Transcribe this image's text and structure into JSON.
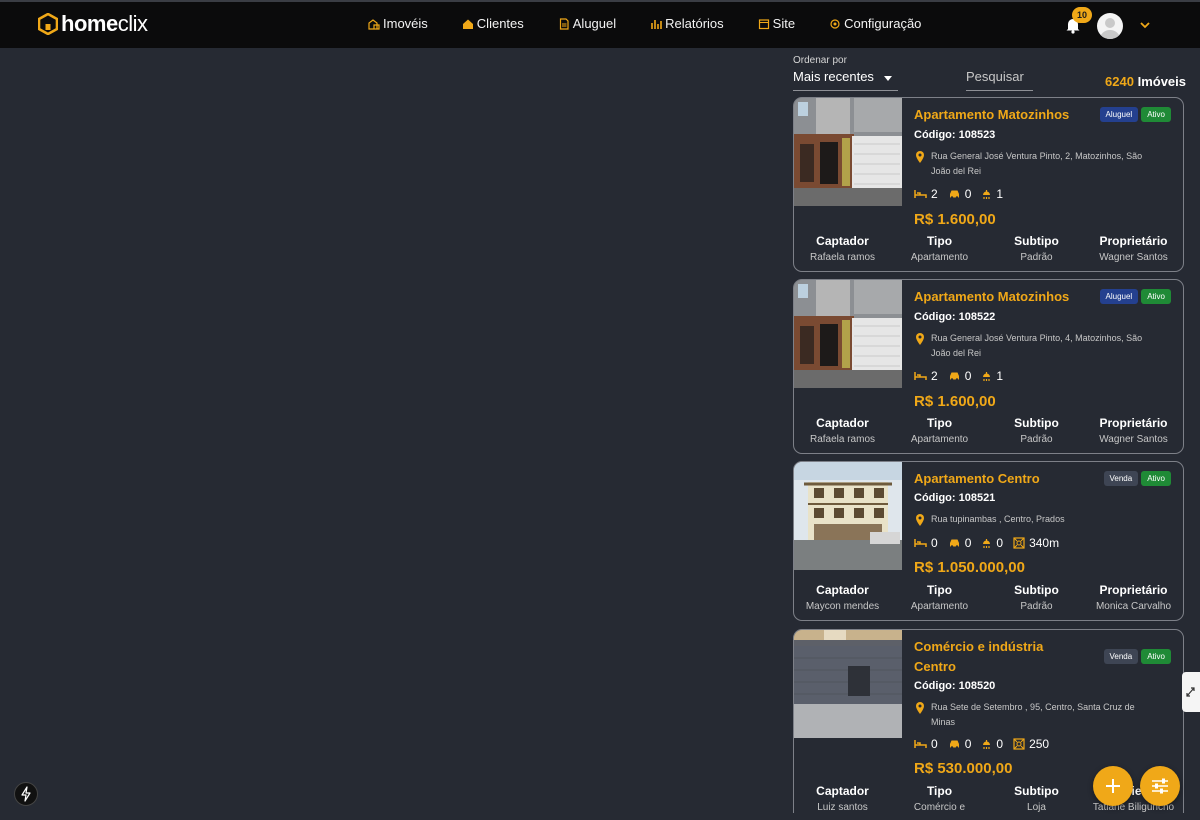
{
  "app": {
    "logo_primary": "home",
    "logo_secondary": "clix",
    "brand_color": "#f0a818"
  },
  "nav": [
    {
      "label": "Imovéis",
      "icon": "buildings-icon"
    },
    {
      "label": "Clientes",
      "icon": "house-icon"
    },
    {
      "label": "Aluguel",
      "icon": "document-icon"
    },
    {
      "label": "Relatórios",
      "icon": "bar-chart-icon"
    },
    {
      "label": "Site",
      "icon": "browser-icon"
    },
    {
      "label": "Configuração",
      "icon": "gear-icon"
    }
  ],
  "notifications": {
    "count": "10"
  },
  "toolbar": {
    "sort_label": "Ordenar por",
    "sort_value": "Mais recentes",
    "search_placeholder": "Pesquisar",
    "count_number": "6240",
    "count_label": "Imóveis"
  },
  "meta_headers": {
    "captador": "Captador",
    "tipo": "Tipo",
    "subtipo": "Subtipo",
    "proprietario": "Proprietário"
  },
  "cards": [
    {
      "title": "Apartamento Matozinhos",
      "deal": "Aluguel",
      "status": "Ativo",
      "code": "Código: 108523",
      "address": "Rua General José Ventura Pinto, 2, Matozinhos, São João del Rei",
      "beds": "2",
      "garage": "0",
      "baths": "1",
      "area": "",
      "price": "R$ 1.600,00",
      "captador": "Rafaela ramos",
      "tipo": "Apartamento",
      "subtipo": "Padrão",
      "proprietario": "Wagner Santos"
    },
    {
      "title": "Apartamento Matozinhos",
      "deal": "Aluguel",
      "status": "Ativo",
      "code": "Código: 108522",
      "address": "Rua General José Ventura Pinto, 4, Matozinhos, São João del Rei",
      "beds": "2",
      "garage": "0",
      "baths": "1",
      "area": "",
      "price": "R$ 1.600,00",
      "captador": "Rafaela ramos",
      "tipo": "Apartamento",
      "subtipo": "Padrão",
      "proprietario": "Wagner Santos"
    },
    {
      "title": "Apartamento Centro",
      "deal": "Venda",
      "status": "Ativo",
      "code": "Código: 108521",
      "address": "Rua tupinambas , Centro, Prados",
      "beds": "0",
      "garage": "0",
      "baths": "0",
      "area": "340m",
      "price": "R$ 1.050.000,00",
      "captador": "Maycon mendes",
      "tipo": "Apartamento",
      "subtipo": "Padrão",
      "proprietario": "Monica Carvalho"
    },
    {
      "title": "Comércio e indústria Centro",
      "deal": "Venda",
      "status": "Ativo",
      "code": "Código: 108520",
      "address": "Rua Sete de Setembro , 95, Centro, Santa Cruz de Minas",
      "beds": "0",
      "garage": "0",
      "baths": "0",
      "area": "250",
      "price": "R$ 530.000,00",
      "captador": "Luiz santos",
      "tipo": "Comércio e",
      "subtipo": "Loja",
      "proprietario": "Tatiane Biliguncho"
    }
  ]
}
